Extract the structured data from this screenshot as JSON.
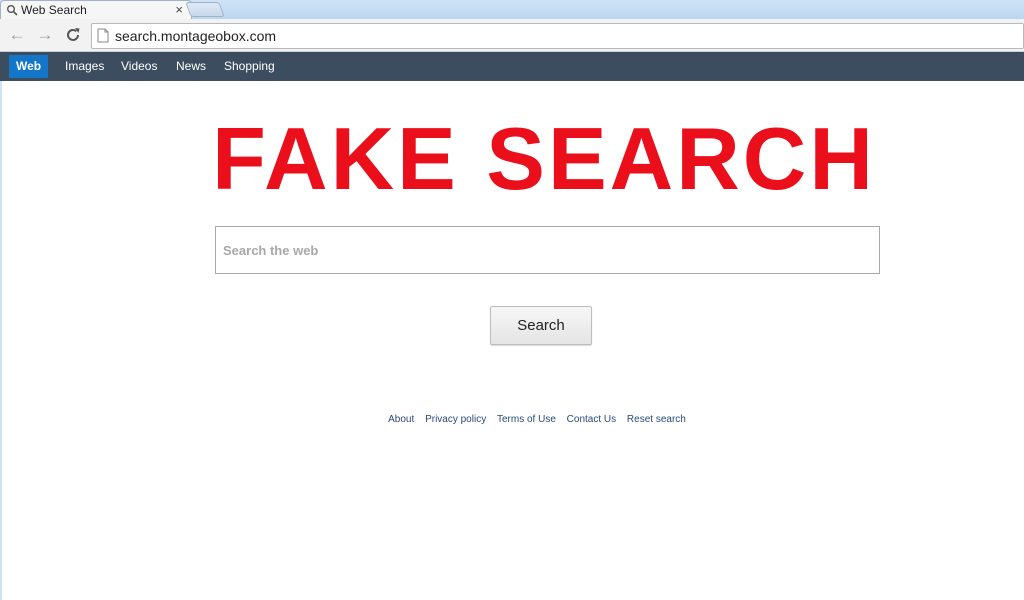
{
  "browser": {
    "tab": {
      "title": "Web Search",
      "close_glyph": "×",
      "favicon": "search-icon"
    },
    "toolbar": {
      "back_glyph": "←",
      "forward_glyph": "→",
      "reload_glyph": "C",
      "url": "search.montageobox.com"
    }
  },
  "site_nav": {
    "items": [
      {
        "label": "Web",
        "active": true
      },
      {
        "label": "Images",
        "active": false
      },
      {
        "label": "Videos",
        "active": false
      },
      {
        "label": "News",
        "active": false
      },
      {
        "label": "Shopping",
        "active": false
      }
    ]
  },
  "main": {
    "headline": "FAKE SEARCH",
    "search_placeholder": "Search the web",
    "search_button": "Search"
  },
  "footer": {
    "links": [
      "About",
      "Privacy policy",
      "Terms of Use",
      "Contact Us",
      "Reset search"
    ]
  },
  "colors": {
    "headline": "#ea0f1a",
    "nav_bar": "#3b4d5e",
    "nav_active": "#1476c8",
    "footer_link": "#2a4a7a"
  }
}
